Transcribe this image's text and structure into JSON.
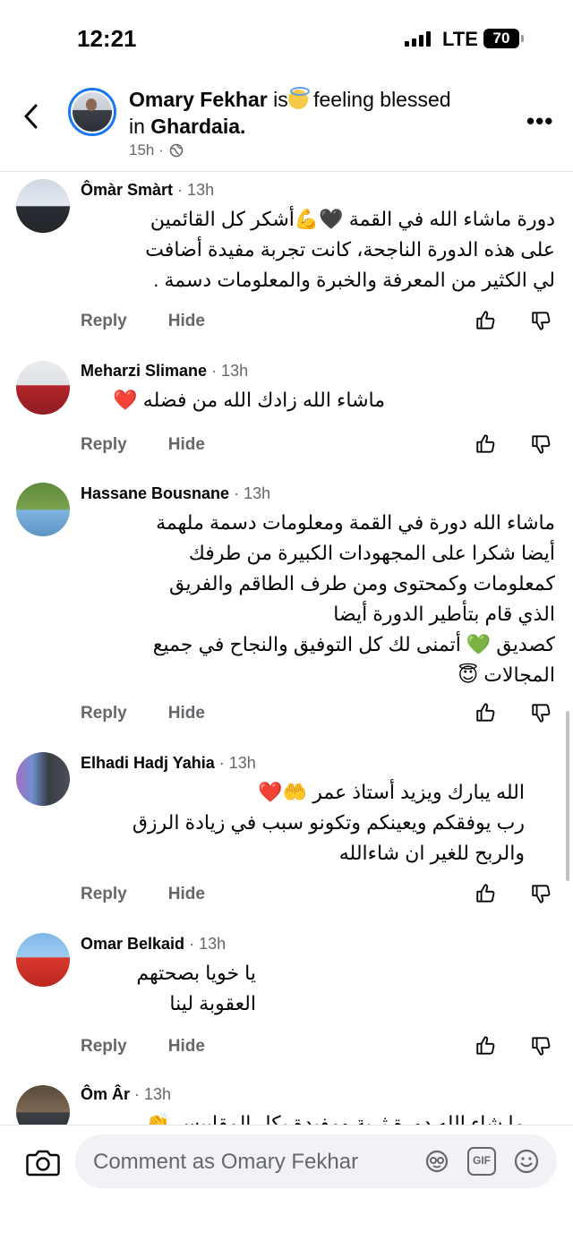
{
  "status_bar": {
    "time": "12:21",
    "network": "LTE",
    "battery": "70"
  },
  "post": {
    "author": "Omary Fekhar",
    "is_text": "is",
    "feeling": "feeling blessed in",
    "location": "Ghardaia.",
    "time": "15h ·"
  },
  "comments": [
    {
      "name": "Ômàr Smàrt",
      "time": "· 13h",
      "lines": [
        "دورة ماشاء الله في القمة 🖤💪أشكر كل القائمين",
        "على هذه الدورة الناجحة، كانت تجربة مفيدة أضافت",
        "لي الكثير من المعرفة والخبرة والمعلومات دسمة ."
      ]
    },
    {
      "name": "Meharzi Slimane",
      "time": "· 13h",
      "lines": [
        "ماشاء الله زادك الله من فضله ❤️"
      ]
    },
    {
      "name": "Hassane Bousnane",
      "time": "· 13h",
      "lines": [
        "ماشاء الله دورة في القمة ومعلومات دسمة ملهمة",
        "أيضا شكرا على المجهودات الكبيرة من طرفك",
        "كمعلومات وكمحتوى ومن طرف الطاقم والفريق",
        "الذي قام بتأطير الدورة أيضا",
        "كصديق 💚 أتمنى لك كل التوفيق والنجاح في جميع",
        "المجالات 😇"
      ]
    },
    {
      "name": "Elhadi Hadj Yahia",
      "time": "· 13h",
      "lines": [
        "الله يبارك ويزيد أستاذ عمر 🤲❤️",
        "رب يوفقكم ويعينكم وتكونو سبب في زيادة الرزق",
        "والربح للغير ان شاءالله"
      ]
    },
    {
      "name": "Omar Belkaid",
      "time": "· 13h",
      "lines": [
        "يا خويا بصحتهم",
        "العقوبة لينا"
      ]
    },
    {
      "name": "Ôm Âr",
      "time": "· 13h",
      "lines": [
        "ما شاء الله دورة ثرية ومفيدة بكل المقاييس 👏"
      ]
    }
  ],
  "actions": {
    "reply": "Reply",
    "hide": "Hide"
  },
  "composer": {
    "placeholder": "Comment as Omary Fekhar",
    "gif": "GIF"
  },
  "icons": [
    "back-icon",
    "more-icon",
    "globe-icon",
    "like-icon",
    "dislike-icon",
    "camera-icon",
    "avatar-frame-icon",
    "gif-icon",
    "emoji-icon"
  ],
  "colors": {
    "accent": "#1877f2",
    "secondary_text": "#65676b",
    "input_bg": "#f0f2f5"
  }
}
